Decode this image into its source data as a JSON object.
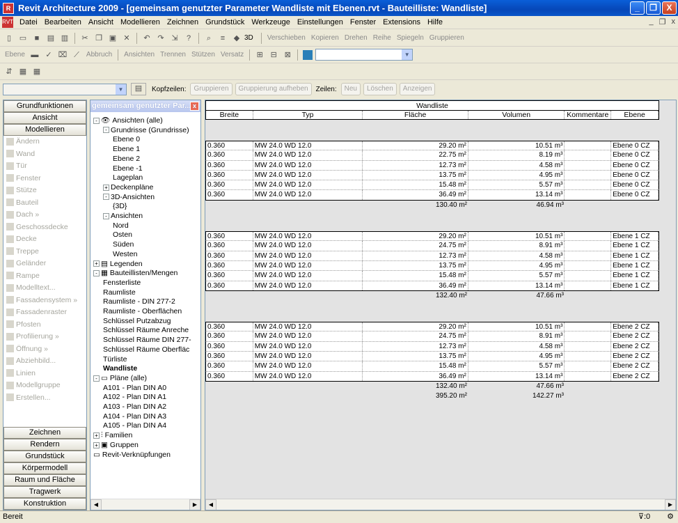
{
  "window": {
    "title": "Revit Architecture 2009 - [gemeinsam genutzter Parameter Wandliste mit Ebenen.rvt - Bauteilliste: Wandliste]",
    "minimize": "_",
    "restore": "❐",
    "close": "X"
  },
  "menu": {
    "items": [
      "Datei",
      "Bearbeiten",
      "Ansicht",
      "Modellieren",
      "Zeichnen",
      "Grundstück",
      "Werkzeuge",
      "Einstellungen",
      "Fenster",
      "Extensions",
      "Hilfe"
    ],
    "doc_controls": [
      "_",
      "❐",
      "x"
    ]
  },
  "toolbar1": {
    "labels": [
      "3D",
      "Verschieben",
      "Kopieren",
      "Drehen",
      "Reihe",
      "Spiegeln",
      "Gruppieren"
    ]
  },
  "toolbar2": {
    "labels": [
      "Ebene",
      "Abbruch",
      "Ansichten",
      "Trennen",
      "Stützen",
      "Versatz"
    ]
  },
  "optionsbar": {
    "kopfzeilen_label": "Kopfzeilen:",
    "gruppieren": "Gruppieren",
    "gruppierung_aufheben": "Gruppierung aufheben",
    "zeilen_label": "Zeilen:",
    "neu": "Neu",
    "loeschen": "Löschen",
    "anzeigen": "Anzeigen"
  },
  "design_bar": {
    "headers_top": [
      "Grundfunktionen",
      "Ansicht",
      "Modellieren"
    ],
    "items": [
      "Ändern",
      "Wand",
      "Tür",
      "Fenster",
      "Stütze",
      "Bauteil",
      "Dach »",
      "Geschossdecke",
      "Decke",
      "Treppe",
      "Geländer",
      "Rampe",
      "Modelltext...",
      "Fassadensystem »",
      "Fassadenraster",
      "Pfosten",
      "Profilierung »",
      "Öffnung »",
      "Abziehbild...",
      "Linien",
      "Modellgruppe",
      "Erstellen..."
    ],
    "headers_bottom": [
      "Zeichnen",
      "Rendern",
      "Grundstück",
      "Körpermodell",
      "Raum und Fläche",
      "Tragwerk",
      "Konstruktion"
    ]
  },
  "project_browser": {
    "title": "gemeinsam genutzter Par...",
    "nodes": [
      {
        "text": "Ansichten (alle)",
        "level": 0,
        "exp": "-",
        "icon": "eye"
      },
      {
        "text": "Grundrisse (Grundrisse)",
        "level": 1,
        "exp": "-"
      },
      {
        "text": "Ebene 0",
        "level": 2
      },
      {
        "text": "Ebene 1",
        "level": 2
      },
      {
        "text": "Ebene 2",
        "level": 2
      },
      {
        "text": "Ebene -1",
        "level": 2
      },
      {
        "text": "Lageplan",
        "level": 2
      },
      {
        "text": "Deckenpläne",
        "level": 1,
        "exp": "+"
      },
      {
        "text": "3D-Ansichten",
        "level": 1,
        "exp": "-"
      },
      {
        "text": "{3D}",
        "level": 2
      },
      {
        "text": "Ansichten",
        "level": 1,
        "exp": "-"
      },
      {
        "text": "Nord",
        "level": 2
      },
      {
        "text": "Osten",
        "level": 2
      },
      {
        "text": "Süden",
        "level": 2
      },
      {
        "text": "Westen",
        "level": 2
      },
      {
        "text": "Legenden",
        "level": 0,
        "exp": "+",
        "icon": "legend"
      },
      {
        "text": "Bauteillisten/Mengen",
        "level": 0,
        "exp": "-",
        "icon": "table"
      },
      {
        "text": "Fensterliste",
        "level": 1
      },
      {
        "text": "Raumliste",
        "level": 1
      },
      {
        "text": "Raumliste - DIN 277-2",
        "level": 1
      },
      {
        "text": "Raumliste - Oberflächen",
        "level": 1
      },
      {
        "text": "Schlüssel Putzabzug",
        "level": 1
      },
      {
        "text": "Schlüssel Räume Anreche",
        "level": 1
      },
      {
        "text": "Schlüssel Räume DIN 277-",
        "level": 1
      },
      {
        "text": "Schlüssel Räume Oberfläc",
        "level": 1
      },
      {
        "text": "Türliste",
        "level": 1
      },
      {
        "text": "Wandliste",
        "level": 1,
        "bold": true
      },
      {
        "text": "Pläne (alle)",
        "level": 0,
        "exp": "-",
        "icon": "sheet"
      },
      {
        "text": "A101 - Plan DIN A0",
        "level": 1
      },
      {
        "text": "A102 - Plan DIN A1",
        "level": 1
      },
      {
        "text": "A103 - Plan DIN A2",
        "level": 1
      },
      {
        "text": "A104 - Plan DIN A3",
        "level": 1
      },
      {
        "text": "A105 - Plan DIN A4",
        "level": 1
      },
      {
        "text": "Familien",
        "level": 0,
        "exp": "+",
        "icon": "family"
      },
      {
        "text": "Gruppen",
        "level": 0,
        "exp": "+",
        "icon": "group"
      },
      {
        "text": "Revit-Verknüpfungen",
        "level": 0,
        "icon": "link"
      }
    ]
  },
  "schedule": {
    "title": "Wandliste",
    "columns": [
      "Breite",
      "Typ",
      "Fläche",
      "Volumen",
      "Kommentare",
      "Ebene"
    ],
    "groups": [
      {
        "rows": [
          [
            "0.360",
            "MW 24.0 WD 12.0",
            "29.20 m²",
            "10.51 m³",
            "",
            "Ebene 0 CZ"
          ],
          [
            "0.360",
            "MW 24.0 WD 12.0",
            "22.75 m²",
            "8.19 m³",
            "",
            "Ebene 0 CZ"
          ],
          [
            "0.360",
            "MW 24.0 WD 12.0",
            "12.73 m²",
            "4.58 m³",
            "",
            "Ebene 0 CZ"
          ],
          [
            "0.360",
            "MW 24.0 WD 12.0",
            "13.75 m²",
            "4.95 m³",
            "",
            "Ebene 0 CZ"
          ],
          [
            "0.360",
            "MW 24.0 WD 12.0",
            "15.48 m²",
            "5.57 m³",
            "",
            "Ebene 0 CZ"
          ],
          [
            "0.360",
            "MW 24.0 WD 12.0",
            "36.49 m²",
            "13.14 m³",
            "",
            "Ebene 0 CZ"
          ]
        ],
        "total_area": "130.40 m²",
        "total_volume": "46.94 m³"
      },
      {
        "rows": [
          [
            "0.360",
            "MW 24.0 WD 12.0",
            "29.20 m²",
            "10.51 m³",
            "",
            "Ebene 1 CZ"
          ],
          [
            "0.360",
            "MW 24.0 WD 12.0",
            "24.75 m²",
            "8.91 m³",
            "",
            "Ebene 1 CZ"
          ],
          [
            "0.360",
            "MW 24.0 WD 12.0",
            "12.73 m²",
            "4.58 m³",
            "",
            "Ebene 1 CZ"
          ],
          [
            "0.360",
            "MW 24.0 WD 12.0",
            "13.75 m²",
            "4.95 m³",
            "",
            "Ebene 1 CZ"
          ],
          [
            "0.360",
            "MW 24.0 WD 12.0",
            "15.48 m²",
            "5.57 m³",
            "",
            "Ebene 1 CZ"
          ],
          [
            "0.360",
            "MW 24.0 WD 12.0",
            "36.49 m²",
            "13.14 m³",
            "",
            "Ebene 1 CZ"
          ]
        ],
        "total_area": "132.40 m²",
        "total_volume": "47.66 m³"
      },
      {
        "rows": [
          [
            "0.360",
            "MW 24.0 WD 12.0",
            "29.20 m²",
            "10.51 m³",
            "",
            "Ebene 2 CZ"
          ],
          [
            "0.360",
            "MW 24.0 WD 12.0",
            "24.75 m²",
            "8.91 m³",
            "",
            "Ebene 2 CZ"
          ],
          [
            "0.360",
            "MW 24.0 WD 12.0",
            "12.73 m²",
            "4.58 m³",
            "",
            "Ebene 2 CZ"
          ],
          [
            "0.360",
            "MW 24.0 WD 12.0",
            "13.75 m²",
            "4.95 m³",
            "",
            "Ebene 2 CZ"
          ],
          [
            "0.360",
            "MW 24.0 WD 12.0",
            "15.48 m²",
            "5.57 m³",
            "",
            "Ebene 2 CZ"
          ],
          [
            "0.360",
            "MW 24.0 WD 12.0",
            "36.49 m²",
            "13.14 m³",
            "",
            "Ebene 2 CZ"
          ]
        ],
        "total_area": "132.40 m²",
        "total_volume": "47.66 m³"
      }
    ],
    "grand_total_area": "395.20 m²",
    "grand_total_volume": "142.27 m³"
  },
  "status": {
    "text": "Bereit",
    "filter": ":0"
  }
}
